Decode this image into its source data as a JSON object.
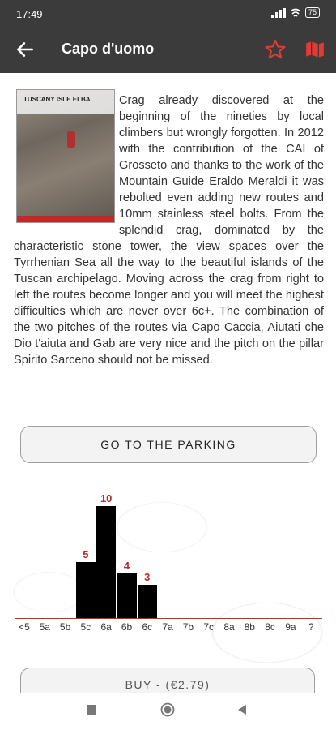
{
  "status": {
    "time": "17:49",
    "battery": "75"
  },
  "appbar": {
    "title": "Capo d'uomo"
  },
  "cover": {
    "text": "TUSCANY ISLE ELBA"
  },
  "description": "Crag already discovered at the beginning of the nineties by local climbers but wrongly forgotten. In 2012 with the contribution of the CAI of Grosseto and thanks to the work of the Mountain Guide Eraldo Meraldi it was rebolted even adding new routes and 10mm stainless steel bolts. From the splendid crag, dominated by the characteristic stone tower, the view spaces over the Tyrrhenian Sea all the way to the beautiful islands of the Tuscan archipelago. Moving across the crag from right to left the routes become longer and you will meet the highest difficulties which are never over 6c+. The combination of the two pitches of the routes via Capo Caccia, Aiutati che Dio t'aiuta and Gab are very nice and the pitch on the pillar Spirito Sarceno should not be missed.",
  "buttons": {
    "parking": "GO TO THE PARKING",
    "buy": "BUY - (€2.79)"
  },
  "chart_data": {
    "type": "bar",
    "categories": [
      "<5",
      "5a",
      "5b",
      "5c",
      "6a",
      "6b",
      "6c",
      "7a",
      "7b",
      "7c",
      "8a",
      "8b",
      "8c",
      "9a",
      "?"
    ],
    "values": [
      0,
      0,
      0,
      5,
      10,
      4,
      3,
      0,
      0,
      0,
      0,
      0,
      0,
      0,
      0
    ],
    "labels": [
      "",
      "",
      "",
      "5",
      "10",
      "4",
      "3",
      "",
      "",
      "",
      "",
      "",
      "",
      "",
      ""
    ],
    "bar_color": "#000000",
    "label_color": "#c62828",
    "axis_color": "#c62828",
    "ylim": [
      0,
      10
    ]
  },
  "colors": {
    "appbar": "#3b3b3b",
    "accent": "#c62828"
  }
}
